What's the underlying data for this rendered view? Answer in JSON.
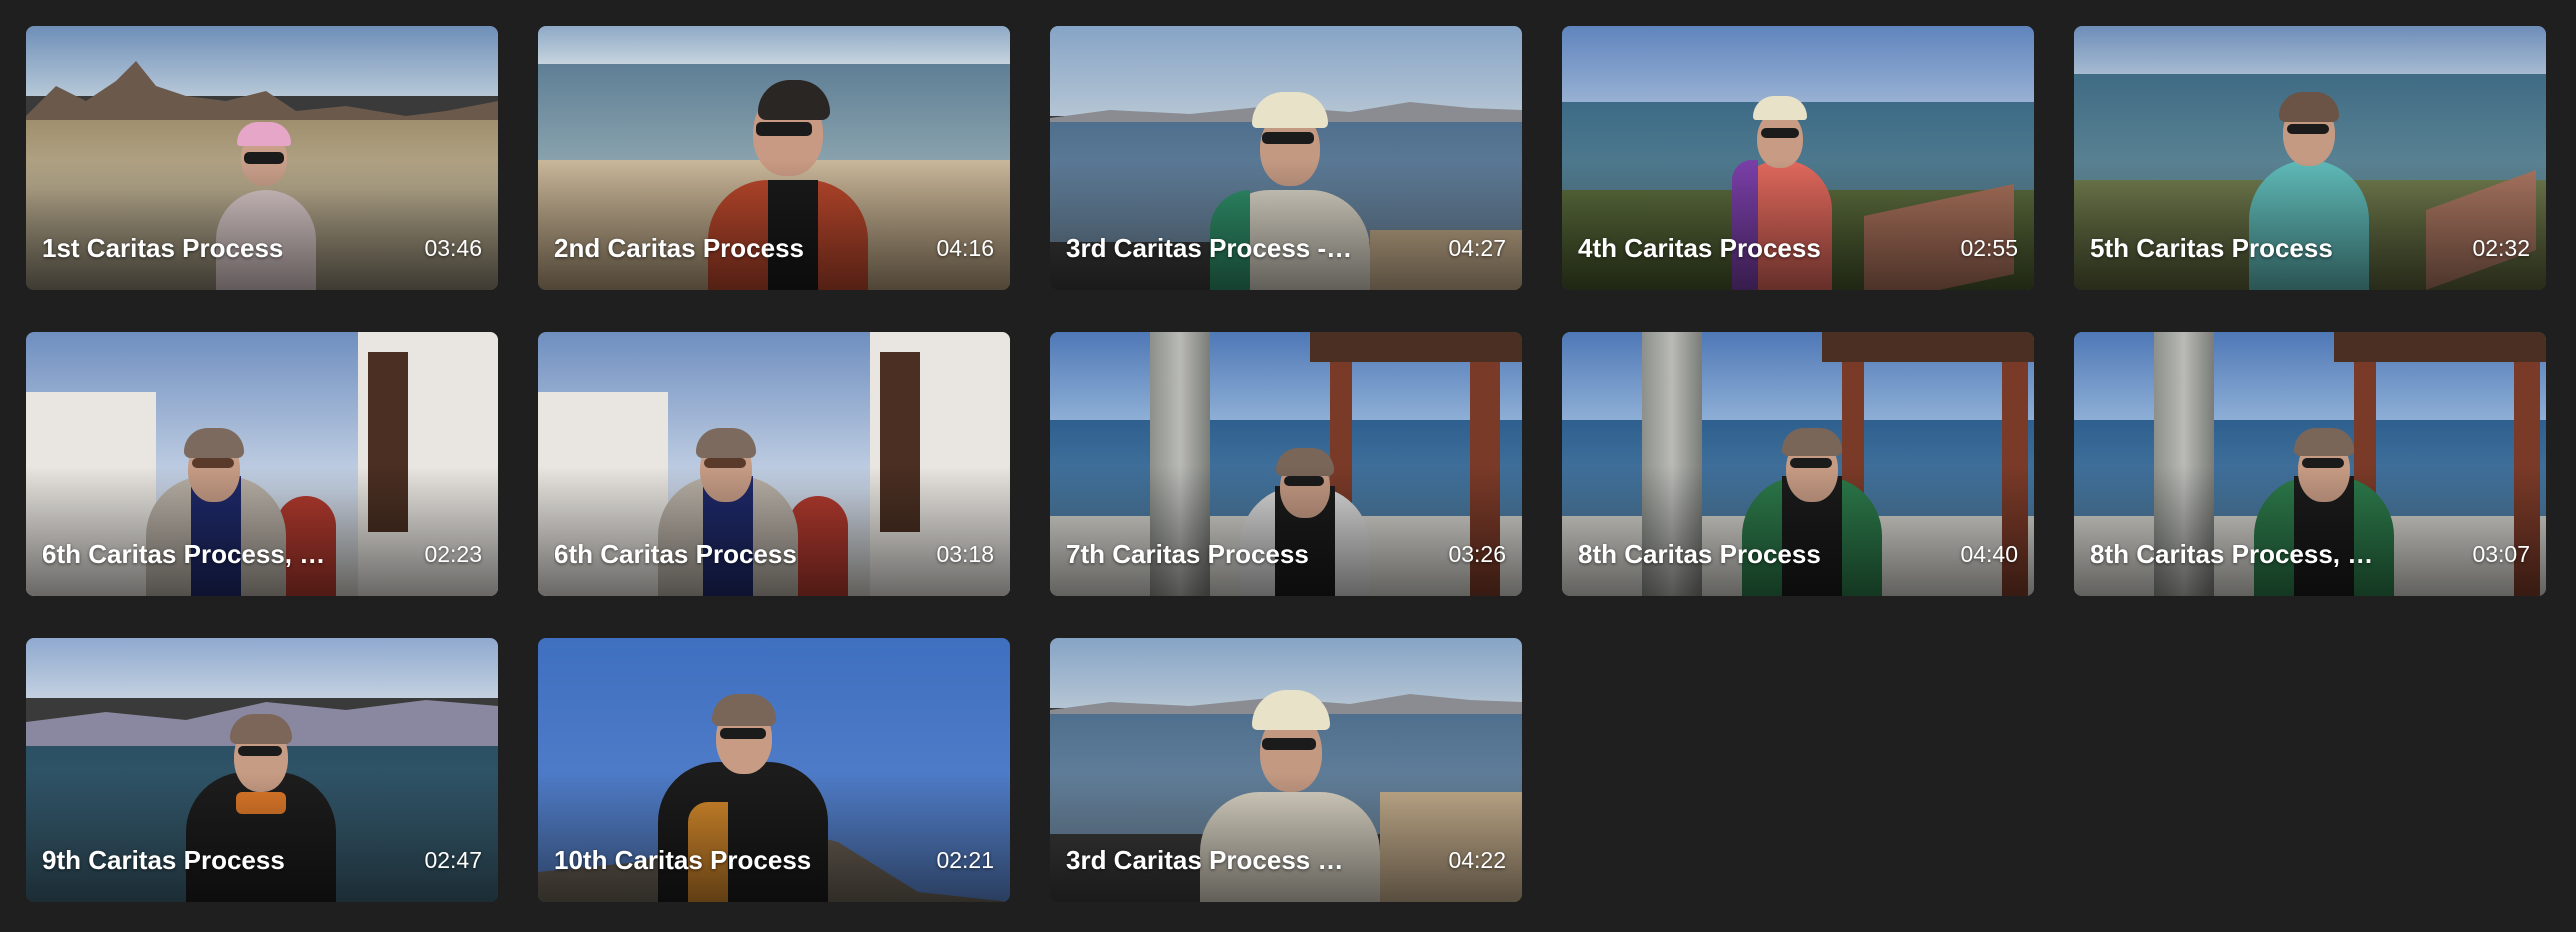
{
  "colors": {
    "background": "#1f1f1f",
    "text": "#ffffff"
  },
  "videos": [
    {
      "title": "1st Caritas Process",
      "duration": "03:46",
      "scene": "desert"
    },
    {
      "title": "2nd Caritas Process",
      "duration": "04:16",
      "scene": "beach"
    },
    {
      "title": "3rd Caritas Process -…",
      "duration": "04:27",
      "scene": "cap-sea"
    },
    {
      "title": "4th Caritas Process",
      "duration": "02:55",
      "scene": "malecon"
    },
    {
      "title": "5th Caritas Process",
      "duration": "02:32",
      "scene": "malecon-2"
    },
    {
      "title": "6th Caritas Process, …",
      "duration": "02:23",
      "scene": "terrace"
    },
    {
      "title": "6th Caritas Process",
      "duration": "03:18",
      "scene": "terrace"
    },
    {
      "title": "7th Caritas Process",
      "duration": "03:26",
      "scene": "pergola"
    },
    {
      "title": "8th Caritas Process",
      "duration": "04:40",
      "scene": "pergola"
    },
    {
      "title": "8th Caritas Process, …",
      "duration": "03:07",
      "scene": "pergola"
    },
    {
      "title": "9th Caritas Process",
      "duration": "02:47",
      "scene": "cliff"
    },
    {
      "title": "10th Caritas Process",
      "duration": "02:21",
      "scene": "hill"
    },
    {
      "title": "3rd Caritas Process …",
      "duration": "04:22",
      "scene": "cap-sea"
    }
  ]
}
